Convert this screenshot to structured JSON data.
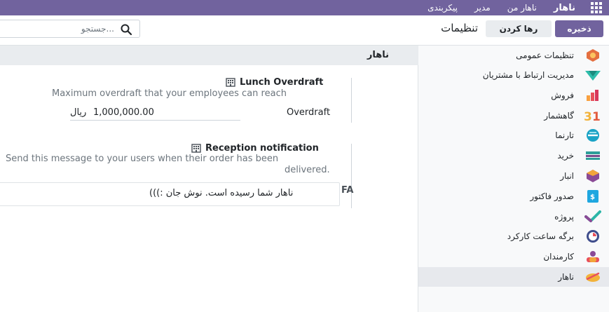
{
  "topbar": {
    "brand": "ناهار",
    "menu": [
      "ناهار من",
      "مدیر",
      "پیکربندی"
    ]
  },
  "controls": {
    "save_label": "ذخیره",
    "discard_label": "رها کردن",
    "page_title": "تنظیمات",
    "search_placeholder": "جستجو..."
  },
  "sidebar": {
    "items": [
      {
        "label": "تنظیمات عمومی",
        "icon": "general-settings-icon"
      },
      {
        "label": "مدیریت ارتباط با مشتریان",
        "icon": "crm-icon"
      },
      {
        "label": "فروش",
        "icon": "sales-icon"
      },
      {
        "label": "گاهشمار",
        "icon": "calendar-icon"
      },
      {
        "label": "تارنما",
        "icon": "website-icon"
      },
      {
        "label": "خرید",
        "icon": "purchase-icon"
      },
      {
        "label": "انبار",
        "icon": "inventory-icon"
      },
      {
        "label": "صدور فاکتور",
        "icon": "invoicing-icon"
      },
      {
        "label": "پروژه",
        "icon": "project-icon"
      },
      {
        "label": "برگه ساعت کارکرد",
        "icon": "timesheets-icon"
      },
      {
        "label": "کارمندان",
        "icon": "employees-icon"
      },
      {
        "label": "ناهار",
        "icon": "lunch-icon",
        "active": true
      }
    ]
  },
  "main": {
    "section_title": "ناهار",
    "overdraft": {
      "title": "Lunch Overdraft",
      "description": "Maximum overdraft that your employees can reach",
      "field_label": "Overdraft",
      "value": "1,000,000.00",
      "currency": "ریال"
    },
    "reception": {
      "title": "Reception notification",
      "description_line1": "Send this message to your users when their order has been",
      "description_line2": "delivered.",
      "lang_badge": "FA",
      "message": "ناهار شما رسیده است. نوش جان :)))"
    }
  },
  "colors": {
    "brand": "#71639e",
    "sidebar_bg": "#f8f9fa",
    "active_item_bg": "#e7e9ed"
  }
}
